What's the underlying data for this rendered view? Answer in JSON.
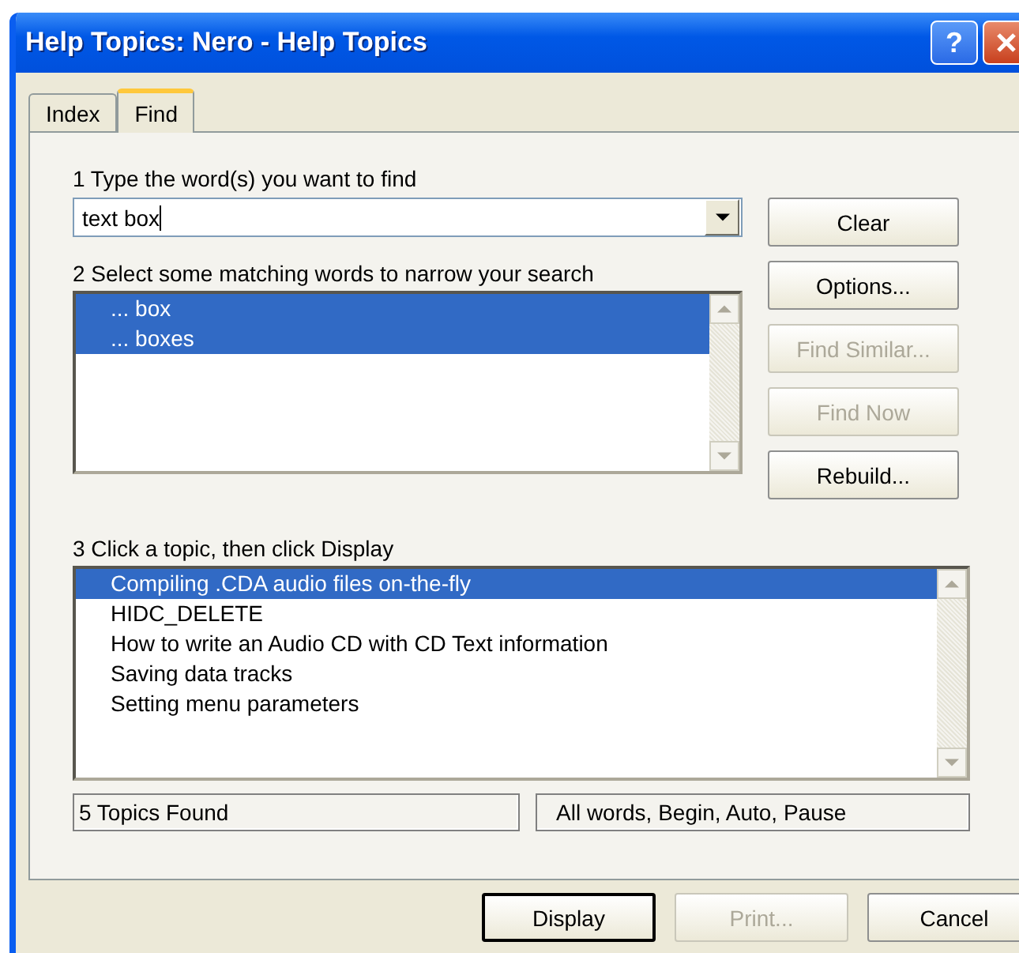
{
  "window": {
    "title": "Help Topics: Nero - Help Topics",
    "help_button": "?"
  },
  "tabs": [
    {
      "label": "Index",
      "selected": false
    },
    {
      "label": "Find",
      "selected": true
    }
  ],
  "step1": {
    "label": "1 Type the word(s) you want to find",
    "value": "text box"
  },
  "step2": {
    "label": "2 Select some matching words to narrow your search",
    "words": [
      {
        "text": "... box",
        "selected": true
      },
      {
        "text": "... boxes",
        "selected": true
      }
    ]
  },
  "side_buttons": [
    {
      "label": "Clear",
      "disabled": false
    },
    {
      "label": "Options...",
      "disabled": false
    },
    {
      "label": "Find Similar...",
      "disabled": true
    },
    {
      "label": "Find Now",
      "disabled": true
    },
    {
      "label": "Rebuild...",
      "disabled": false
    }
  ],
  "step3": {
    "label": "3 Click a topic, then click Display",
    "topics": [
      {
        "text": "Compiling .CDA audio files on-the-fly",
        "selected": true
      },
      {
        "text": "HIDC_DELETE",
        "selected": false
      },
      {
        "text": "How to write an Audio CD with CD Text information",
        "selected": false
      },
      {
        "text": "Saving data tracks",
        "selected": false
      },
      {
        "text": "Setting menu parameters",
        "selected": false
      }
    ]
  },
  "status": {
    "count": "5 Topics Found",
    "options": "All words, Begin, Auto, Pause"
  },
  "buttons": [
    {
      "label": "Display",
      "disabled": false,
      "default": true
    },
    {
      "label": "Print...",
      "disabled": true,
      "default": false
    },
    {
      "label": "Cancel",
      "disabled": false,
      "default": false
    }
  ]
}
